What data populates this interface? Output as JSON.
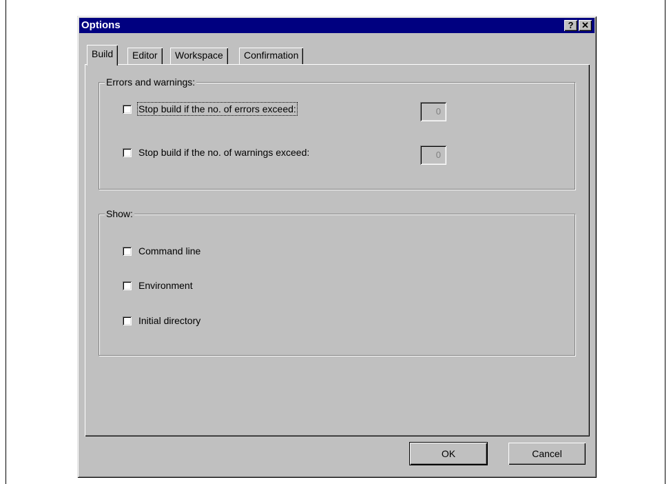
{
  "window": {
    "title": "Options",
    "help_glyph": "?",
    "close_glyph": "✕"
  },
  "tabs": [
    {
      "label": "Build",
      "active": true
    },
    {
      "label": "Editor",
      "active": false
    },
    {
      "label": "Workspace",
      "active": false
    },
    {
      "label": "Confirmation",
      "active": false
    }
  ],
  "errors_group": {
    "legend": "Errors and warnings:",
    "stop_errors": {
      "label": "Stop build if the no. of errors exceed:",
      "checked": false,
      "value": "0"
    },
    "stop_warnings": {
      "label": "Stop build if the no. of warnings exceed:",
      "checked": false,
      "value": "0"
    }
  },
  "show_group": {
    "legend": "Show:",
    "items": [
      {
        "label": "Command line",
        "checked": false
      },
      {
        "label": "Environment",
        "checked": false
      },
      {
        "label": "Initial directory",
        "checked": false
      }
    ]
  },
  "buttons": {
    "ok": "OK",
    "cancel": "Cancel"
  }
}
